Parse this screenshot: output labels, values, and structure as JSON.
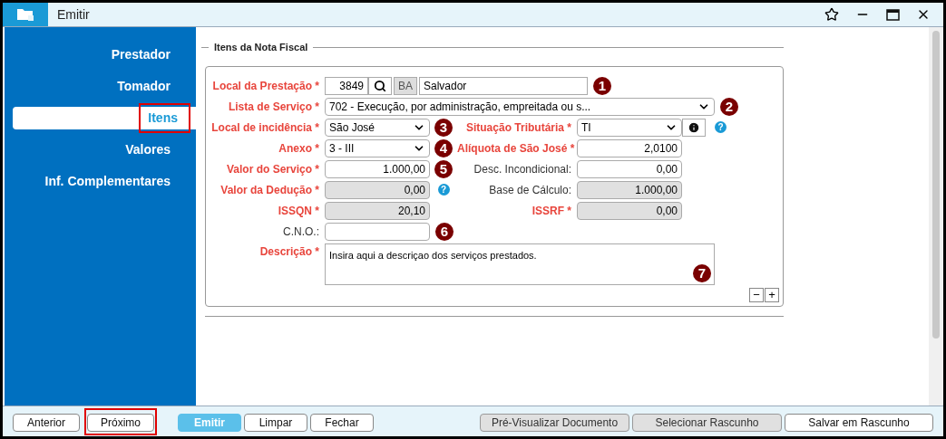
{
  "window": {
    "title": "Emitir"
  },
  "sidebar": {
    "items": [
      {
        "label": "Prestador",
        "selected": false,
        "highlighted": false
      },
      {
        "label": "Tomador",
        "selected": false,
        "highlighted": false
      },
      {
        "label": "Itens",
        "selected": true,
        "highlighted": true
      },
      {
        "label": "Valores",
        "selected": false,
        "highlighted": false
      },
      {
        "label": "Inf. Complementares",
        "selected": false,
        "highlighted": false
      }
    ]
  },
  "section": {
    "title": "Itens da Nota Fiscal"
  },
  "form": {
    "rows": [
      {
        "kind": "lookup",
        "label": "Local da Prestação *",
        "required": true,
        "code": "3849",
        "uf": "BA",
        "city": "Salvador",
        "marker": "1"
      },
      {
        "kind": "wide_select",
        "label": "Lista de Serviço *",
        "required": true,
        "value": "702 - Execução, por administração, empreitada ou s...",
        "marker": "2"
      },
      {
        "kind": "pair",
        "marker": "3",
        "left": {
          "kind": "select",
          "label": "Local de incidência *",
          "required": true,
          "value": "São José",
          "disabled": false
        },
        "right": {
          "kind": "select_info",
          "label": "Situação Tributária *",
          "required": true,
          "value": "TI",
          "disabled": false,
          "help": "?"
        }
      },
      {
        "kind": "pair",
        "marker": "4",
        "left": {
          "kind": "select",
          "label": "Anexo *",
          "required": true,
          "value": "3 - III",
          "disabled": false
        },
        "right": {
          "kind": "text",
          "label": "Alíquota de São José *",
          "required": true,
          "value": "2,0100",
          "disabled": false
        }
      },
      {
        "kind": "pair",
        "marker": "5",
        "left": {
          "kind": "text",
          "label": "Valor do Serviço *",
          "required": true,
          "value": "1.000,00",
          "disabled": false
        },
        "right": {
          "kind": "text",
          "label": "Desc. Incondicional:",
          "required": false,
          "value": "0,00",
          "disabled": false
        }
      },
      {
        "kind": "pair",
        "help": "?",
        "left": {
          "kind": "text",
          "label": "Valor da Dedução *",
          "required": true,
          "value": "0,00",
          "disabled": true
        },
        "right": {
          "kind": "text",
          "label": "Base de Cálculo:",
          "required": false,
          "value": "1.000,00",
          "disabled": true
        }
      },
      {
        "kind": "pair",
        "left": {
          "kind": "text",
          "label": "ISSQN *",
          "required": true,
          "value": "20,10",
          "disabled": true
        },
        "right": {
          "kind": "text",
          "label": "ISSRF *",
          "required": true,
          "value": "0,00",
          "disabled": true
        }
      },
      {
        "kind": "single",
        "marker": "6",
        "label": "C.N.O.:",
        "required": false,
        "value": ""
      },
      {
        "kind": "textarea",
        "marker": "7",
        "label": "Descrição *",
        "required": true,
        "value": "Insira aqui a descriçao dos serviços prestados."
      }
    ],
    "remove": "−",
    "add": "+"
  },
  "footer": {
    "left": [
      {
        "label": "Anterior",
        "disabled": false,
        "primary": false,
        "highlighted": false
      },
      {
        "label": "Próximo",
        "disabled": false,
        "primary": false,
        "highlighted": true
      }
    ],
    "middle": [
      {
        "label": "Emitir",
        "disabled": false,
        "primary": true,
        "highlighted": false
      },
      {
        "label": "Limpar",
        "disabled": false,
        "primary": false,
        "highlighted": false
      },
      {
        "label": "Fechar",
        "disabled": false,
        "primary": false,
        "highlighted": false
      }
    ],
    "right": [
      {
        "label": "Pré-Visualizar Documento",
        "disabled": true,
        "primary": false,
        "highlighted": false
      },
      {
        "label": "Selecionar Rascunho",
        "disabled": true,
        "primary": false,
        "highlighted": false
      },
      {
        "label": "Salvar em Rascunho",
        "disabled": false,
        "primary": false,
        "highlighted": false
      }
    ]
  }
}
